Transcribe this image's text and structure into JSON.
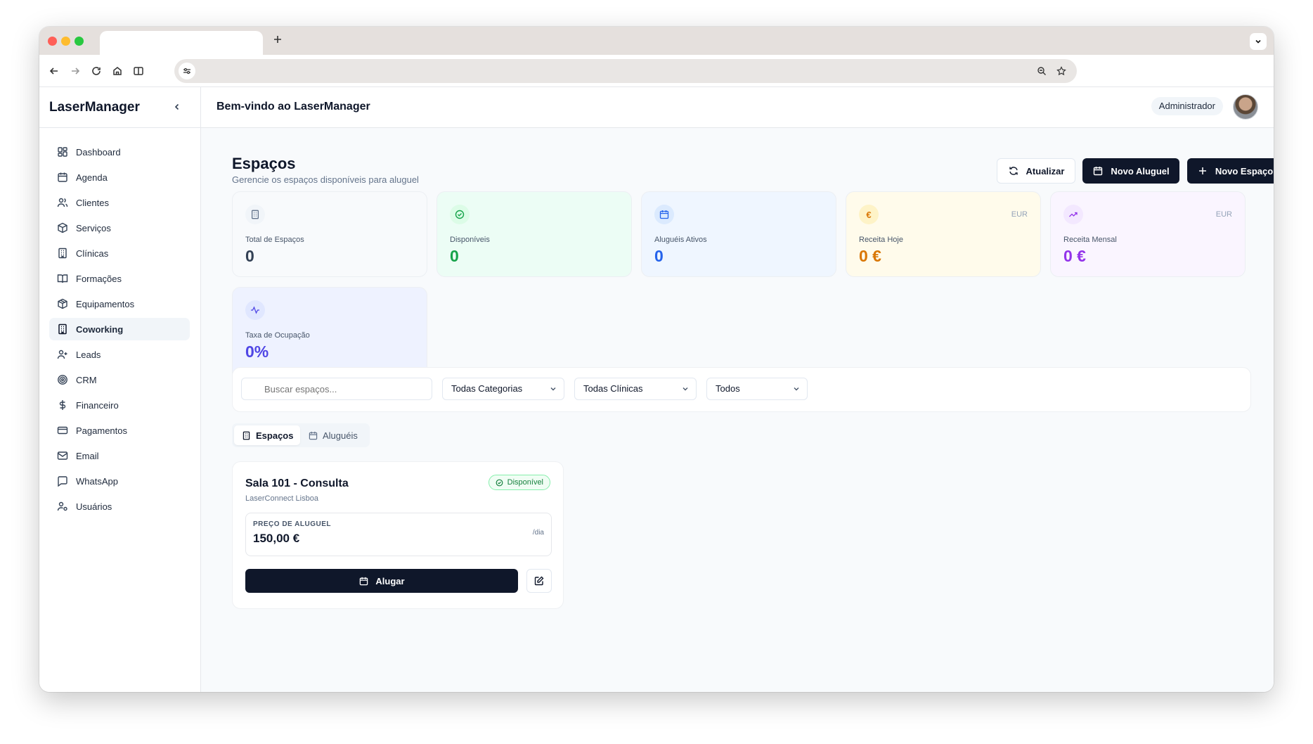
{
  "browser": {
    "new_tab_icon": "plus-icon",
    "nav_icons": [
      "arrow-left-icon",
      "arrow-right-icon",
      "reload-icon",
      "home-icon",
      "reading-view-icon"
    ],
    "url_icons": [
      "site-settings-icon",
      "zoom-icon",
      "star-icon"
    ]
  },
  "sidebar": {
    "brand": "LaserManager",
    "items": [
      {
        "label": "Dashboard",
        "icon": "dashboard-icon"
      },
      {
        "label": "Agenda",
        "icon": "calendar-icon"
      },
      {
        "label": "Clientes",
        "icon": "users-icon"
      },
      {
        "label": "Serviços",
        "icon": "package-icon"
      },
      {
        "label": "Clínicas",
        "icon": "building-icon"
      },
      {
        "label": "Formações",
        "icon": "book-icon"
      },
      {
        "label": "Equipamentos",
        "icon": "box-icon"
      },
      {
        "label": "Coworking",
        "icon": "building-icon",
        "active": true
      },
      {
        "label": "Leads",
        "icon": "user-plus-icon"
      },
      {
        "label": "CRM",
        "icon": "target-icon"
      },
      {
        "label": "Financeiro",
        "icon": "dollar-icon"
      },
      {
        "label": "Pagamentos",
        "icon": "credit-card-icon"
      },
      {
        "label": "Email",
        "icon": "mail-icon"
      },
      {
        "label": "WhatsApp",
        "icon": "message-icon"
      },
      {
        "label": "Usuários",
        "icon": "user-cog-icon"
      }
    ]
  },
  "header": {
    "welcome": "Bem-vindo ao LaserManager",
    "role": "Administrador"
  },
  "page": {
    "title": "Espaços",
    "subtitle": "Gerencie os espaços disponíveis para aluguel",
    "buttons": {
      "refresh": "Atualizar",
      "new_rental": "Novo Aluguel",
      "new_space": "Novo Espaço"
    }
  },
  "stats": [
    {
      "label": "Total de Espaços",
      "value": "0",
      "icon": "building-icon",
      "currency": ""
    },
    {
      "label": "Disponíveis",
      "value": "0",
      "icon": "check-circle-icon",
      "currency": ""
    },
    {
      "label": "Aluguéis Ativos",
      "value": "0",
      "icon": "calendar-icon",
      "currency": ""
    },
    {
      "label": "Receita Hoje",
      "value": "0 €",
      "icon": "euro-icon",
      "currency": "EUR"
    },
    {
      "label": "Receita Mensal",
      "value": "0 €",
      "icon": "trending-up-icon",
      "currency": "EUR"
    },
    {
      "label": "Taxa de Ocupação",
      "value": "0%",
      "icon": "activity-icon",
      "currency": ""
    }
  ],
  "colors": {
    "primary": "#0f172a",
    "available_green": "#16a34a",
    "active_blue": "#2563eb",
    "revenue_orange": "#d97706",
    "monthly_purple": "#9333ea",
    "occupancy_indigo": "#4f46e5"
  },
  "filters": {
    "search_placeholder": "Buscar espaços...",
    "category": "Todas Categorias",
    "clinic": "Todas Clínicas",
    "status": "Todos"
  },
  "tabs": [
    {
      "label": "Espaços",
      "active": true
    },
    {
      "label": "Aluguéis",
      "active": false
    }
  ],
  "space_card": {
    "title": "Sala 101 - Consulta",
    "clinic": "LaserConnect Lisboa",
    "status": "Disponível",
    "price_label": "PREÇO DE ALUGUEL",
    "price": "150,00 €",
    "unit": "/dia",
    "rent_button": "Alugar"
  }
}
